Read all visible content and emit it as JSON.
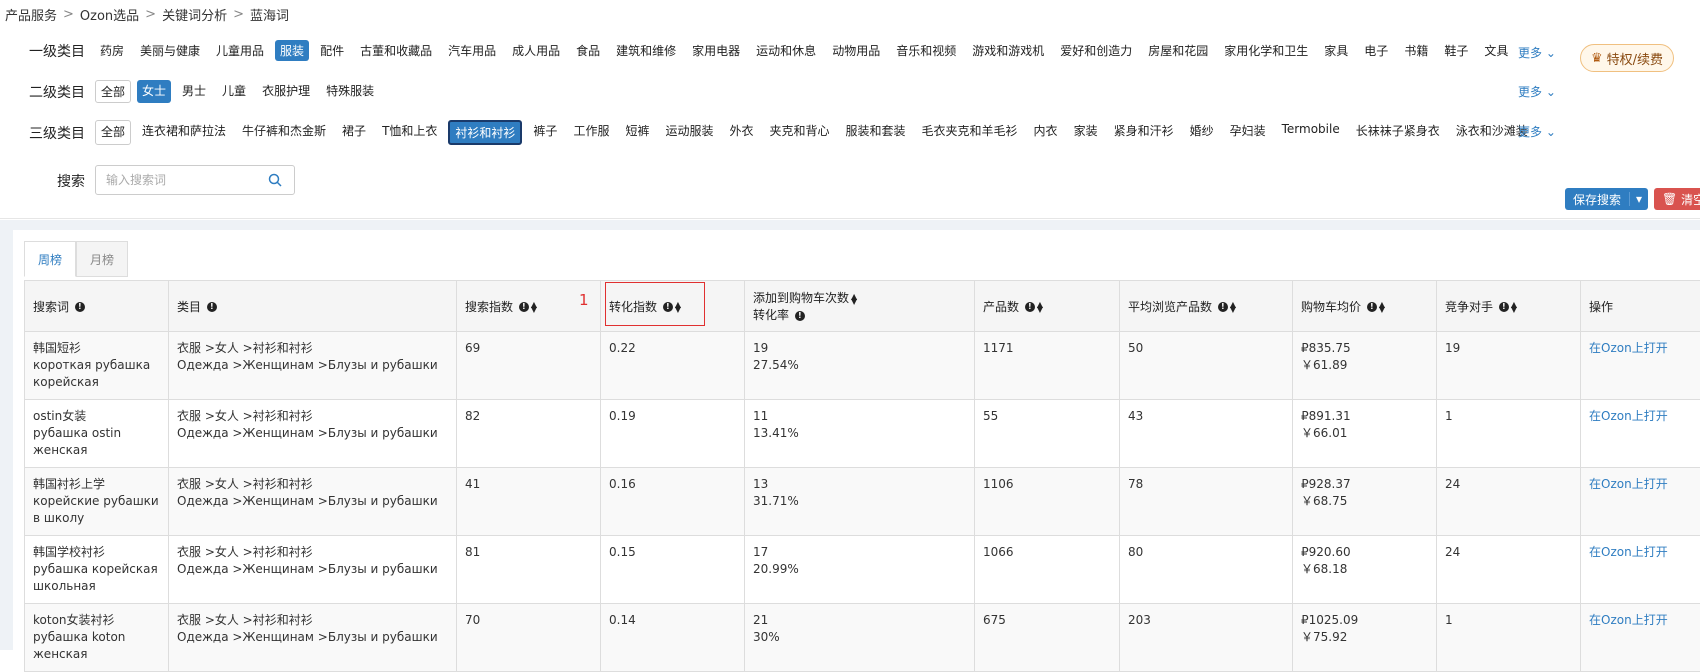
{
  "breadcrumb": [
    "产品服务",
    "Ozon选品",
    "关键词分析",
    "蓝海词"
  ],
  "filters": {
    "level1": {
      "label": "一级类目",
      "items": [
        "药房",
        "美丽与健康",
        "儿童用品",
        "服装",
        "配件",
        "古董和收藏品",
        "汽车用品",
        "成人用品",
        "食品",
        "建筑和维修",
        "家用电器",
        "运动和休息",
        "动物用品",
        "音乐和视频",
        "游戏和游戏机",
        "爱好和创造力",
        "房屋和花园",
        "家用化学和卫生",
        "家具",
        "电子",
        "书籍",
        "鞋子",
        "文具"
      ],
      "active": 3,
      "more": "更多"
    },
    "level2": {
      "label": "二级类目",
      "items": [
        "全部",
        "女士",
        "男士",
        "儿童",
        "衣服护理",
        "特殊服装"
      ],
      "active": 1,
      "more": "更多"
    },
    "level3": {
      "label": "三级类目",
      "items": [
        "全部",
        "连衣裙和萨拉法",
        "牛仔裤和杰金斯",
        "裙子",
        "T恤和上衣",
        "衬衫和衬衫",
        "裤子",
        "工作服",
        "短裤",
        "运动服装",
        "外衣",
        "夹克和背心",
        "服装和套装",
        "毛衣夹克和羊毛衫",
        "内衣",
        "家装",
        "紧身和汗衫",
        "婚纱",
        "孕妇装",
        "Termobile",
        "长袜袜子紧身衣",
        "泳衣和沙滩装"
      ],
      "active": 5,
      "more": "更多"
    },
    "search": {
      "label": "搜索",
      "placeholder": "输入搜索词"
    }
  },
  "vip_label": "特权/续费",
  "save_label": "保存搜索",
  "clear_label": "清空",
  "tabs": [
    "周榜",
    "月榜"
  ],
  "highlight_number": "1",
  "table": {
    "headers": [
      "搜索词",
      "类目",
      "搜索指数",
      "转化指数",
      "添加到购物车次数",
      "转化率",
      "产品数",
      "平均浏览产品数",
      "购物车均价",
      "竞争对手",
      "操作"
    ],
    "rows": [
      {
        "kw_cn": "韩国短衫",
        "kw_ru": "короткая рубашка корейская",
        "cat_cn": "衣服 >女人 >衬衫和衬衫",
        "cat_ru": "Одежда >Женщинам >Блузы и рубашки",
        "search": "69",
        "conv": "0.22",
        "cart": "19",
        "rate": "27.54%",
        "products": "1171",
        "avg_view": "50",
        "price_rub": "₽835.75",
        "price_cny": "￥61.89",
        "competitors": "19",
        "action": "在Ozon上打开"
      },
      {
        "kw_cn": "ostin女装",
        "kw_ru": "рубашка ostin женская",
        "cat_cn": "衣服 >女人 >衬衫和衬衫",
        "cat_ru": "Одежда >Женщинам >Блузы и рубашки",
        "search": "82",
        "conv": "0.19",
        "cart": "11",
        "rate": "13.41%",
        "products": "55",
        "avg_view": "43",
        "price_rub": "₽891.31",
        "price_cny": "￥66.01",
        "competitors": "1",
        "action": "在Ozon上打开"
      },
      {
        "kw_cn": "韩国衬衫上学",
        "kw_ru": "корейские рубашки в школу",
        "cat_cn": "衣服 >女人 >衬衫和衬衫",
        "cat_ru": "Одежда >Женщинам >Блузы и рубашки",
        "search": "41",
        "conv": "0.16",
        "cart": "13",
        "rate": "31.71%",
        "products": "1106",
        "avg_view": "78",
        "price_rub": "₽928.37",
        "price_cny": "￥68.75",
        "competitors": "24",
        "action": "在Ozon上打开"
      },
      {
        "kw_cn": "韩国学校衬衫",
        "kw_ru": "рубашка корейская школьная",
        "cat_cn": "衣服 >女人 >衬衫和衬衫",
        "cat_ru": "Одежда >Женщинам >Блузы и рубашки",
        "search": "81",
        "conv": "0.15",
        "cart": "17",
        "rate": "20.99%",
        "products": "1066",
        "avg_view": "80",
        "price_rub": "₽920.60",
        "price_cny": "￥68.18",
        "competitors": "24",
        "action": "在Ozon上打开"
      },
      {
        "kw_cn": "koton女装衬衫",
        "kw_ru": "рубашка koton женская",
        "cat_cn": "衣服 >女人 >衬衫和衬衫",
        "cat_ru": "Одежда >Женщинам >Блузы и рубашки",
        "search": "70",
        "conv": "0.14",
        "cart": "21",
        "rate": "30%",
        "products": "675",
        "avg_view": "203",
        "price_rub": "₽1025.09",
        "price_cny": "￥75.92",
        "competitors": "1",
        "action": "在Ozon上打开"
      }
    ]
  }
}
